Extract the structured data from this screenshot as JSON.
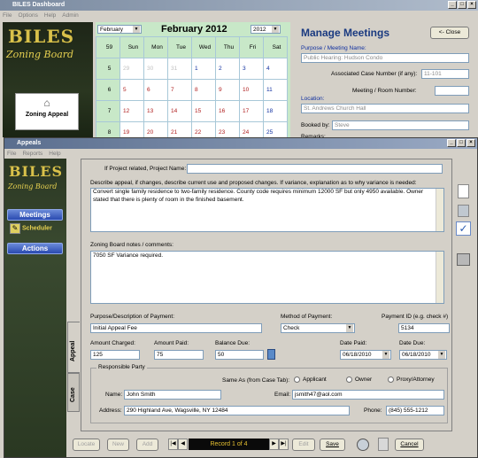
{
  "back_window": {
    "title": "BILES Dashboard",
    "menu": [
      "File",
      "Options",
      "Help",
      "Admin"
    ],
    "logo_line1": "BILES",
    "logo_line2": "Zoning Board",
    "zoning_appeal_btn": "Zoning Appeal",
    "calendar": {
      "month_select": "February",
      "title": "February 2012",
      "year_select": "2012",
      "corner": "59",
      "days": [
        "Sun",
        "Mon",
        "Tue",
        "Wed",
        "Thu",
        "Fri",
        "Sat"
      ],
      "rows": [
        {
          "week": "5",
          "cells": [
            "29",
            "30",
            "31",
            "1",
            "2",
            "3",
            "4"
          ]
        },
        {
          "week": "6",
          "cells": [
            "5",
            "6",
            "7",
            "8",
            "9",
            "10",
            "11"
          ]
        },
        {
          "week": "7",
          "cells": [
            "12",
            "13",
            "14",
            "15",
            "16",
            "17",
            "18"
          ]
        },
        {
          "week": "8",
          "cells": [
            "19",
            "20",
            "21",
            "22",
            "23",
            "24",
            "25"
          ]
        }
      ]
    },
    "manage": {
      "title": "Manage Meetings",
      "close": "<- Close",
      "purpose_label": "Purpose / Meeting Name:",
      "purpose_value": "Public Hearing: Hudson Condo",
      "case_label": "Associated Case Number (if any):",
      "case_value": "11-101",
      "room_label": "Meeting / Room Number:",
      "room_value": "",
      "location_label": "Location:",
      "location_value": "St. Andrews Church Hall",
      "booked_label": "Booked by:",
      "booked_value": "Steve",
      "remarks_label": "Remarks:"
    }
  },
  "front_window": {
    "title": "Appeals",
    "menu": [
      "File",
      "Reports",
      "Help"
    ],
    "logo_line1": "BILES",
    "logo_line2": "Zoning Board",
    "nav": {
      "meetings": "Meetings",
      "scheduler": "Scheduler",
      "actions": "Actions"
    },
    "form": {
      "project_label": "If Project related, Project Name:",
      "project_value": "",
      "describe_label": "Describe appeal, if changes, describe current use and proposed changes. If variance, explanation as to why variance is needed:",
      "describe_value": "Convert single family residence to two-family residence. County code requires minimum 12000 SF but only 4950 available. Owner stated that there is plenty of room in the finished basement.",
      "notes_label": "Zoning Board notes / comments:",
      "notes_value": "7050 SF Variance required.",
      "purpose_label": "Purpose/Description of Payment:",
      "purpose_value": "Initial Appeal Fee",
      "method_label": "Method of Payment:",
      "method_value": "Check",
      "payment_id_label": "Payment ID (e.g. check #)",
      "payment_id_value": "5134",
      "charged_label": "Amount Charged:",
      "charged_value": "125",
      "paid_label": "Amount Paid:",
      "paid_value": "75",
      "balance_label": "Balance Due:",
      "balance_value": "50",
      "date_paid_label": "Date Paid:",
      "date_paid_value": "06/18/2010",
      "date_due_label": "Date Due:",
      "date_due_value": "06/18/2010",
      "party_legend": "Responsible Party",
      "same_as_label": "Same As (from Case Tab):",
      "radio_applicant": "Applicant",
      "radio_owner": "Owner",
      "radio_proxy": "Proxy/Attorney",
      "name_label": "Name:",
      "name_value": "John Smith",
      "email_label": "Email:",
      "email_value": "jsmith47@aol.com",
      "address_label": "Address:",
      "address_value": "290 Highland Ave, Wagsville, NY 12484",
      "phone_label": "Phone:",
      "phone_value": "(845) 555-1212"
    },
    "tabs": {
      "appeal": "Appeal",
      "case": "Case"
    },
    "toolbar": {
      "locate": "Locate",
      "new": "New",
      "add": "Add",
      "record": "Record 1 of 4",
      "edit": "Edit",
      "save": "Save",
      "cancel": "Cancel"
    }
  }
}
